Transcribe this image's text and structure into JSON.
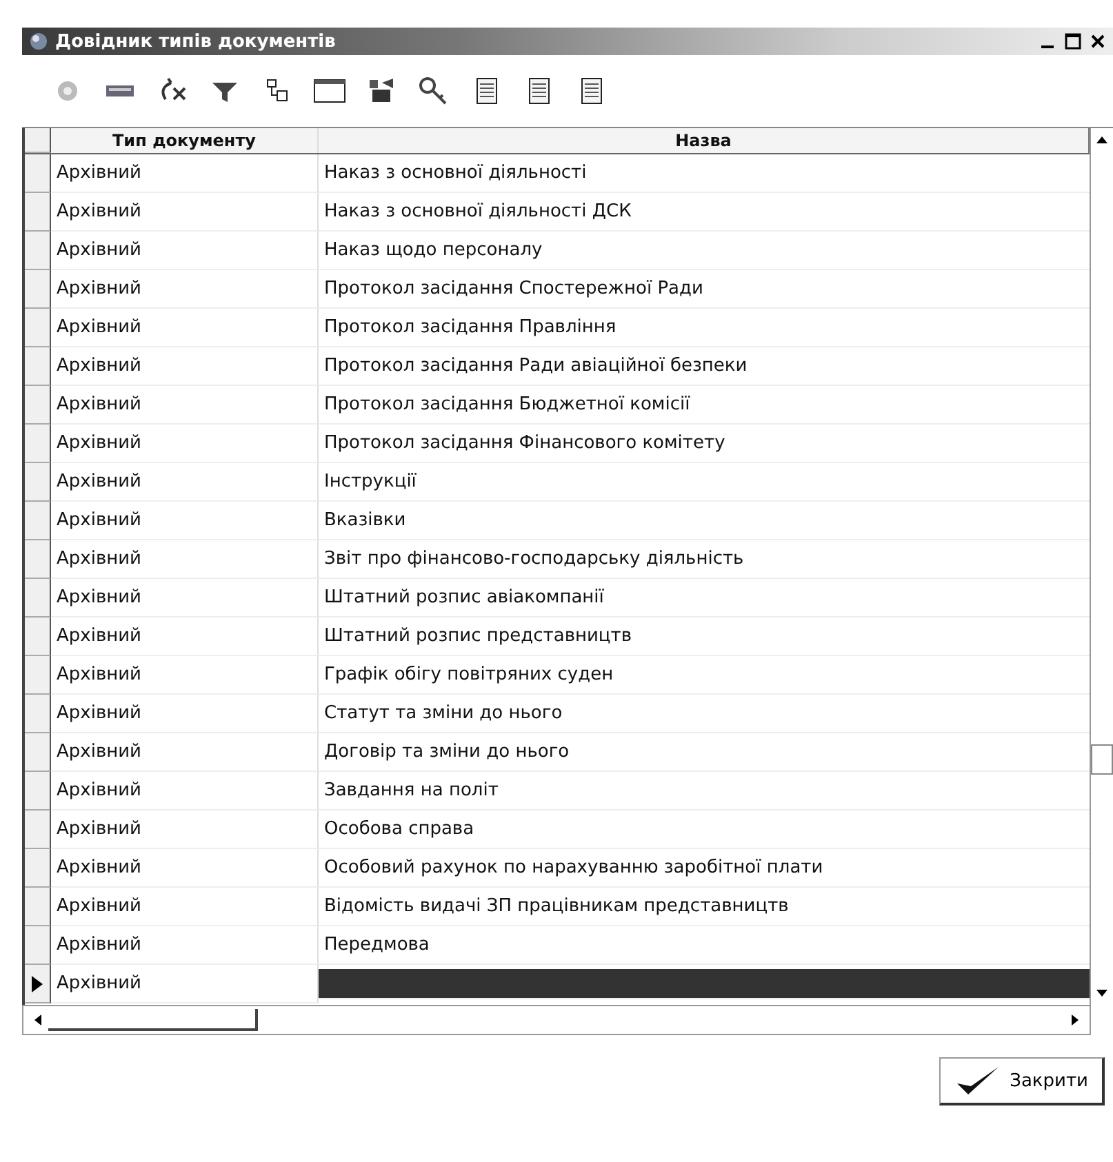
{
  "window": {
    "title": "Довідник типів документів"
  },
  "table": {
    "columns": [
      "Тип документу",
      "Назва"
    ],
    "rows": [
      {
        "type": "Архівний",
        "name": "Наказ з основної діяльності",
        "selected": false
      },
      {
        "type": "Архівний",
        "name": "Наказ з основної діяльності ДСК",
        "selected": false
      },
      {
        "type": "Архівний",
        "name": "Наказ щодо персоналу",
        "selected": false
      },
      {
        "type": "Архівний",
        "name": "Протокол засідання Спостережної Ради",
        "selected": false
      },
      {
        "type": "Архівний",
        "name": "Протокол засідання Правління",
        "selected": false
      },
      {
        "type": "Архівний",
        "name": "Протокол засідання Ради авіаційної безпеки",
        "selected": false
      },
      {
        "type": "Архівний",
        "name": "Протокол засідання Бюджетної комісії",
        "selected": false
      },
      {
        "type": "Архівний",
        "name": "Протокол засідання Фінансового комітету",
        "selected": false
      },
      {
        "type": "Архівний",
        "name": "Інструкції",
        "selected": false
      },
      {
        "type": "Архівний",
        "name": "Вказівки",
        "selected": false
      },
      {
        "type": "Архівний",
        "name": "Звіт про фінансово-господарську діяльність",
        "selected": false
      },
      {
        "type": "Архівний",
        "name": "Штатний розпис авіакомпанії",
        "selected": false
      },
      {
        "type": "Архівний",
        "name": "Штатний розпис представництв",
        "selected": false
      },
      {
        "type": "Архівний",
        "name": "Графік обігу повітряних суден",
        "selected": false
      },
      {
        "type": "Архівний",
        "name": "Статут та зміни до нього",
        "selected": false
      },
      {
        "type": "Архівний",
        "name": "Договір та зміни до нього",
        "selected": false
      },
      {
        "type": "Архівний",
        "name": "Завдання на політ",
        "selected": false
      },
      {
        "type": "Архівний",
        "name": "Особова справа",
        "selected": false
      },
      {
        "type": "Архівний",
        "name": "Особовий рахунок по нарахуванню заробітної плати",
        "selected": false
      },
      {
        "type": "Архівний",
        "name": "Відомість видачі ЗП працівникам представництв",
        "selected": false
      },
      {
        "type": "Архівний",
        "name": "Передмова",
        "selected": false
      },
      {
        "type": "Архівний",
        "selected": true
      }
    ]
  },
  "buttons": {
    "close": "Закрити"
  }
}
